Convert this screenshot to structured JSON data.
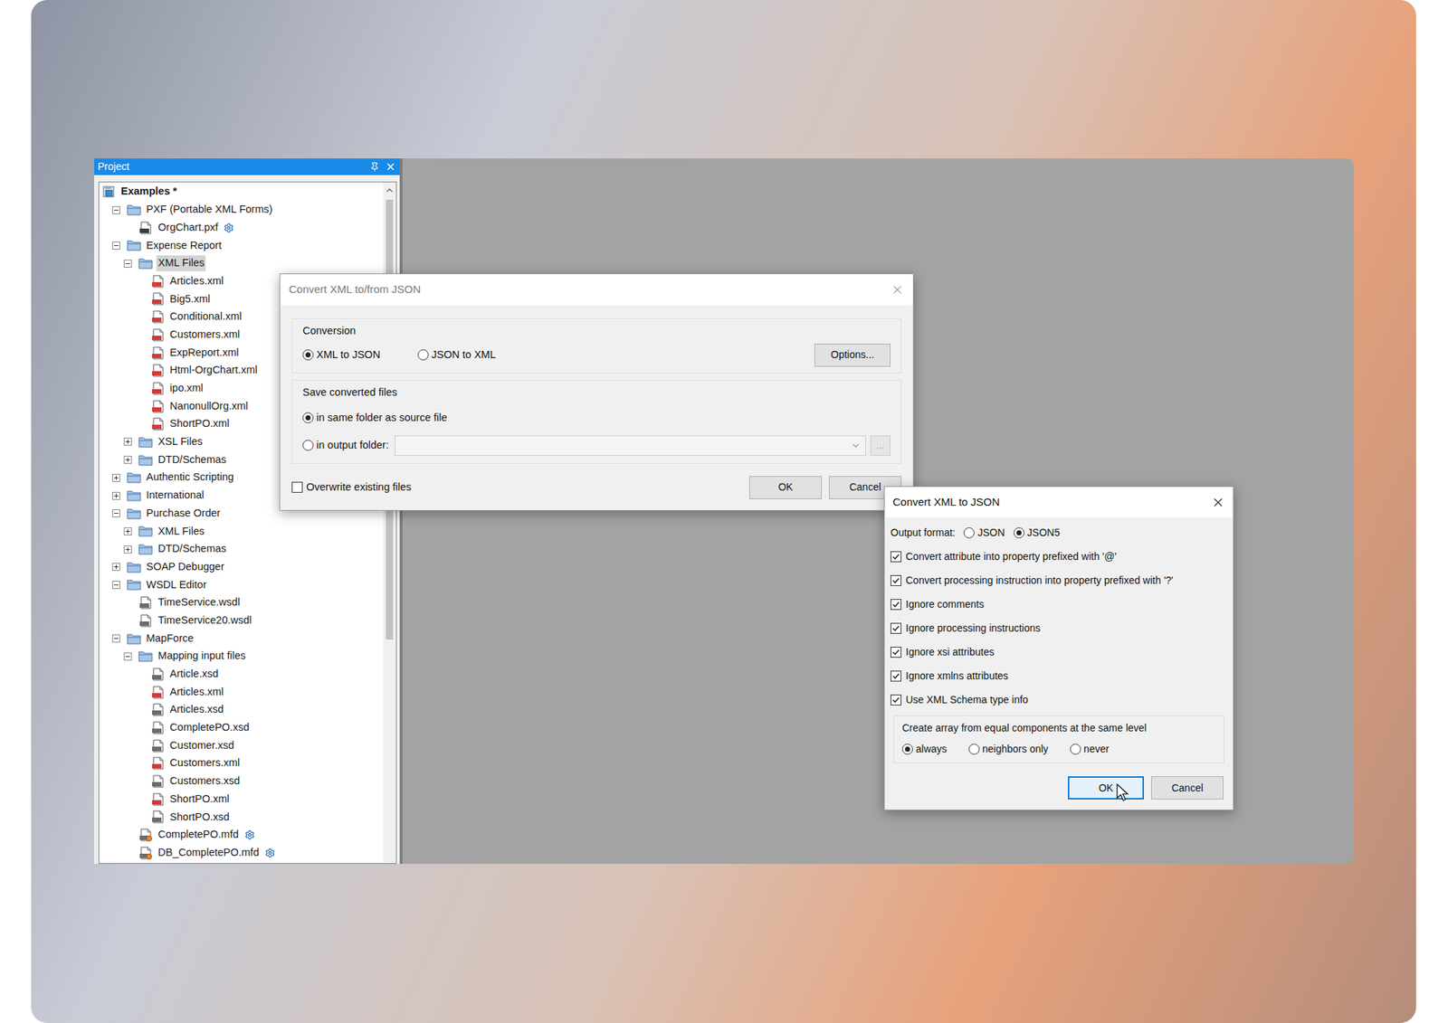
{
  "project_panel": {
    "title": "Project"
  },
  "tree": [
    {
      "label": "Examples *",
      "depth": 0,
      "kind": "project",
      "expanded": true,
      "selected": false,
      "badge": false
    },
    {
      "label": "PXF (Portable XML Forms)",
      "depth": 1,
      "kind": "folder",
      "expanded": true,
      "selected": false,
      "badge": false
    },
    {
      "label": "OrgChart.pxf",
      "depth": 2,
      "kind": "pxf",
      "selected": false,
      "badge": true
    },
    {
      "label": "Expense Report",
      "depth": 1,
      "kind": "folder",
      "expanded": true,
      "selected": false,
      "badge": false
    },
    {
      "label": "XML Files",
      "depth": 2,
      "kind": "folder",
      "expanded": true,
      "selected": true,
      "badge": false
    },
    {
      "label": "Articles.xml",
      "depth": 3,
      "kind": "xml",
      "selected": false,
      "badge": false
    },
    {
      "label": "Big5.xml",
      "depth": 3,
      "kind": "xml",
      "selected": false,
      "badge": false
    },
    {
      "label": "Conditional.xml",
      "depth": 3,
      "kind": "xml",
      "selected": false,
      "badge": false
    },
    {
      "label": "Customers.xml",
      "depth": 3,
      "kind": "xml",
      "selected": false,
      "badge": false
    },
    {
      "label": "ExpReport.xml",
      "depth": 3,
      "kind": "xml",
      "selected": false,
      "badge": false
    },
    {
      "label": "Html-OrgChart.xml",
      "depth": 3,
      "kind": "xml",
      "selected": false,
      "badge": false
    },
    {
      "label": "ipo.xml",
      "depth": 3,
      "kind": "xml",
      "selected": false,
      "badge": false
    },
    {
      "label": "NanonullOrg.xml",
      "depth": 3,
      "kind": "xml",
      "selected": false,
      "badge": false
    },
    {
      "label": "ShortPO.xml",
      "depth": 3,
      "kind": "xml",
      "selected": false,
      "badge": false
    },
    {
      "label": "XSL Files",
      "depth": 2,
      "kind": "folder",
      "expanded": false,
      "selected": false,
      "badge": false
    },
    {
      "label": "DTD/Schemas",
      "depth": 2,
      "kind": "folder",
      "expanded": false,
      "selected": false,
      "badge": false
    },
    {
      "label": "Authentic Scripting",
      "depth": 1,
      "kind": "folder",
      "expanded": false,
      "selected": false,
      "badge": false
    },
    {
      "label": "International",
      "depth": 1,
      "kind": "folder",
      "expanded": false,
      "selected": false,
      "badge": false
    },
    {
      "label": "Purchase Order",
      "depth": 1,
      "kind": "folder",
      "expanded": true,
      "selected": false,
      "badge": false
    },
    {
      "label": "XML Files",
      "depth": 2,
      "kind": "folder",
      "expanded": false,
      "selected": false,
      "badge": false
    },
    {
      "label": "DTD/Schemas",
      "depth": 2,
      "kind": "folder",
      "expanded": false,
      "selected": false,
      "badge": false
    },
    {
      "label": "SOAP Debugger",
      "depth": 1,
      "kind": "folder",
      "expanded": false,
      "selected": false,
      "badge": false
    },
    {
      "label": "WSDL Editor",
      "depth": 1,
      "kind": "folder",
      "expanded": true,
      "selected": false,
      "badge": false
    },
    {
      "label": "TimeService.wsdl",
      "depth": 2,
      "kind": "wsdl",
      "selected": false,
      "badge": false
    },
    {
      "label": "TimeService20.wsdl",
      "depth": 2,
      "kind": "wsdl",
      "selected": false,
      "badge": false
    },
    {
      "label": "MapForce",
      "depth": 1,
      "kind": "folder",
      "expanded": true,
      "selected": false,
      "badge": false
    },
    {
      "label": "Mapping input files",
      "depth": 2,
      "kind": "folder",
      "expanded": true,
      "selected": false,
      "badge": false
    },
    {
      "label": "Article.xsd",
      "depth": 3,
      "kind": "xsd",
      "selected": false,
      "badge": false
    },
    {
      "label": "Articles.xml",
      "depth": 3,
      "kind": "xml",
      "selected": false,
      "badge": false
    },
    {
      "label": "Articles.xsd",
      "depth": 3,
      "kind": "xsd",
      "selected": false,
      "badge": false
    },
    {
      "label": "CompletePO.xsd",
      "depth": 3,
      "kind": "xsd",
      "selected": false,
      "badge": false
    },
    {
      "label": "Customer.xsd",
      "depth": 3,
      "kind": "xsd",
      "selected": false,
      "badge": false
    },
    {
      "label": "Customers.xml",
      "depth": 3,
      "kind": "xml",
      "selected": false,
      "badge": false
    },
    {
      "label": "Customers.xsd",
      "depth": 3,
      "kind": "xsd",
      "selected": false,
      "badge": false
    },
    {
      "label": "ShortPO.xml",
      "depth": 3,
      "kind": "xml",
      "selected": false,
      "badge": false
    },
    {
      "label": "ShortPO.xsd",
      "depth": 3,
      "kind": "xsd",
      "selected": false,
      "badge": false
    },
    {
      "label": "CompletePO.mfd",
      "depth": 2,
      "kind": "mfd",
      "selected": false,
      "badge": true
    },
    {
      "label": "DB_CompletePO.mfd",
      "depth": 2,
      "kind": "mfd",
      "selected": false,
      "badge": true
    }
  ],
  "convert_dialog": {
    "title": "Convert XML to/from JSON",
    "active": false,
    "conversion": {
      "label": "Conversion",
      "options": [
        {
          "label": "XML to JSON",
          "selected": true
        },
        {
          "label": "JSON to XML",
          "selected": false
        }
      ],
      "options_button": "Options..."
    },
    "save": {
      "label": "Save converted files",
      "options": [
        {
          "label": "in same folder as source file",
          "selected": true,
          "kind": "plain"
        },
        {
          "label": "in output folder:",
          "selected": false,
          "kind": "folder"
        }
      ],
      "folder_value": "",
      "folder_disabled": true,
      "browse_button": "..."
    },
    "overwrite": {
      "label": "Overwrite existing files",
      "checked": false
    },
    "buttons": [
      {
        "label": "OK",
        "focused": false
      },
      {
        "label": "Cancel",
        "focused": false
      }
    ]
  },
  "options_dialog": {
    "title": "Convert XML to JSON",
    "active": true,
    "output_format": {
      "label": "Output format:",
      "options": [
        {
          "label": "JSON",
          "selected": false
        },
        {
          "label": "JSON5",
          "selected": true
        }
      ]
    },
    "checkboxes": [
      {
        "label": "Convert attribute into property prefixed with '@'",
        "checked": true
      },
      {
        "label": "Convert processing instruction into property prefixed with '?'",
        "checked": true
      },
      {
        "label": "Ignore comments",
        "checked": true
      },
      {
        "label": "Ignore processing instructions",
        "checked": true
      },
      {
        "label": "Ignore xsi attributes",
        "checked": true
      },
      {
        "label": "Ignore xmlns attributes",
        "checked": true
      },
      {
        "label": "Use XML Schema type info",
        "checked": true
      }
    ],
    "array": {
      "label": "Create array from equal components at the same level",
      "options": [
        {
          "label": "always",
          "selected": true
        },
        {
          "label": "neighbors only",
          "selected": false
        },
        {
          "label": "never",
          "selected": false
        }
      ]
    },
    "buttons": [
      {
        "label": "OK",
        "focused": true
      },
      {
        "label": "Cancel",
        "focused": false
      }
    ]
  }
}
